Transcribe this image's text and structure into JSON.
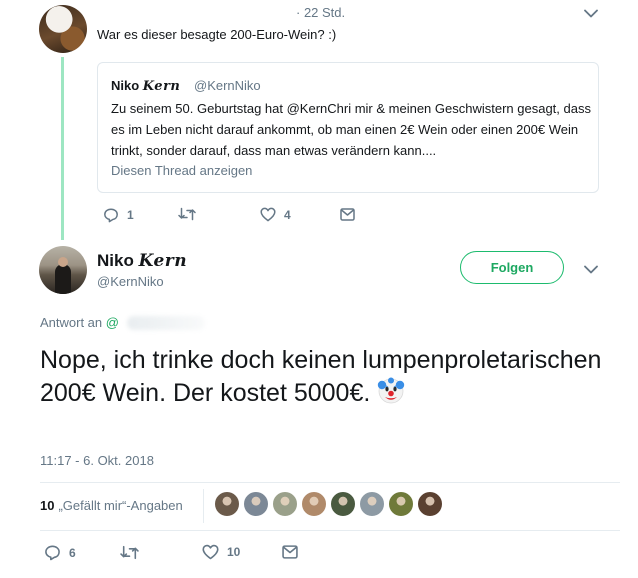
{
  "reply": {
    "time": "· 22 Std.",
    "text": "War es dieser besagte 200-Euro-Wein? :)",
    "quote": {
      "name_plain": "Niko ",
      "name_fancy": "Kern",
      "handle": "@KernNiko",
      "body": "Zu seinem 50. Geburtstag hat @KernChri mir & meinen Geschwistern gesagt, dass es im Leben nicht darauf ankommt, ob man einen 2€ Wein oder einen 200€ Wein trinkt, sonder darauf, dass man etwas verändern kann....",
      "link": "Diesen Thread anzeigen"
    },
    "actions": {
      "reply_count": "1",
      "retweet_count": "",
      "like_count": "4"
    }
  },
  "main": {
    "name_plain": "Niko ",
    "name_fancy": "Kern",
    "handle": "@KernNiko",
    "follow_label": "Folgen",
    "reply_to_label": "Antwort an",
    "reply_to_at": "@",
    "text": "Nope, ich trinke doch keinen lumpenproletarischen 200€ Wein. Der kostet 5000€.",
    "timestamp": "11:17 - 6. Okt. 2018",
    "likes_count": "10",
    "likes_label": "„Gefällt mir“-Angaben",
    "actions": {
      "reply_count": "6",
      "retweet_count": "",
      "like_count": "10"
    }
  },
  "colors": {
    "accent_green": "#1da861",
    "thread_line": "#9de6c2",
    "muted": "#657786",
    "likers": [
      "#6b5a4a",
      "#7c8896",
      "#9aa08a",
      "#b08a6a",
      "#4a5a40",
      "#8d9aa4",
      "#6f7a3a",
      "#5a4030"
    ]
  },
  "icons": [
    "chevron-down-icon",
    "reply-icon",
    "retweet-icon",
    "heart-icon",
    "dm-icon",
    "clown-emoji"
  ]
}
